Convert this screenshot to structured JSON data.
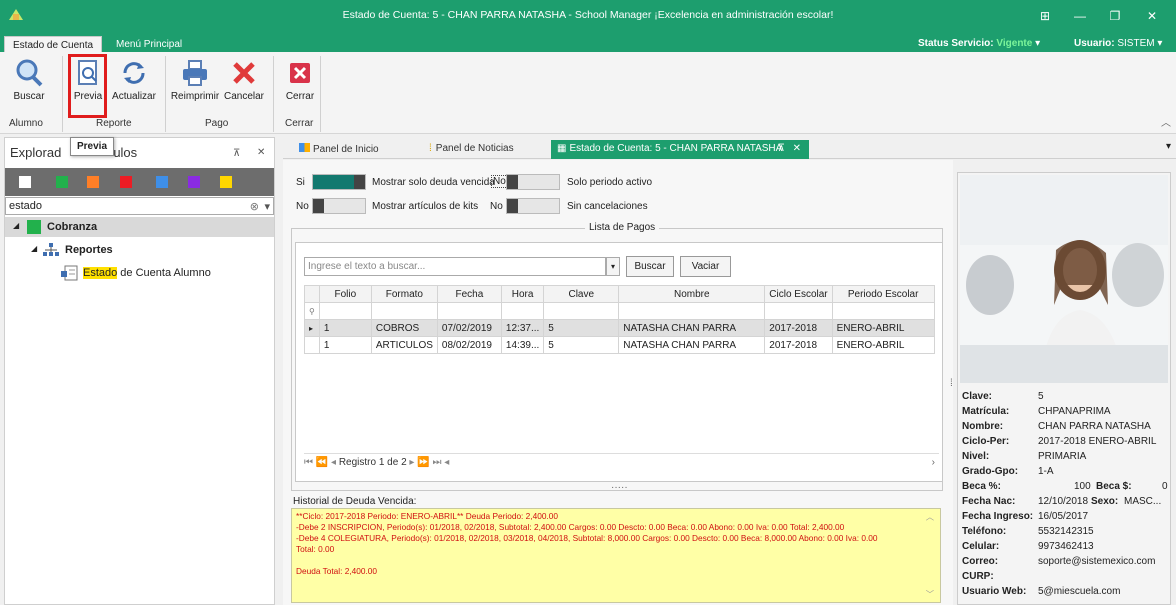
{
  "window": {
    "title": "Estado de Cuenta: 5 - CHAN PARRA NATASHA - School Manager ¡Excelencia en administración escolar!"
  },
  "ribbon_tabs": [
    "Estado de Cuenta",
    "Menú Principal"
  ],
  "status": {
    "servicio_label": "Status Servicio:",
    "servicio_value": "Vigente",
    "usuario_label": "Usuario:",
    "usuario_value": "SISTEM"
  },
  "ribbon": {
    "buttons": {
      "buscar": "Buscar",
      "previa": "Previa",
      "actualizar": "Actualizar",
      "reimprimir": "Reimprimir",
      "cancelar": "Cancelar",
      "cerrar": "Cerrar"
    },
    "groups": [
      "Alumno",
      "Reporte",
      "Pago",
      "Cerrar"
    ]
  },
  "tooltip": "Previa",
  "explorer": {
    "title_start": "Explorad",
    "title_end": "ulos",
    "filter_value": "estado",
    "swatch_colors": [
      "#ffffff",
      "#22b14c",
      "#ff7f27",
      "#ed1c24",
      "#3f8fe8",
      "#8a2be2",
      "#ffd700"
    ],
    "tree": {
      "category": "Cobranza",
      "subcategory": "Reportes",
      "item_highlight": "Estado",
      "item_rest": " de Cuenta Alumno"
    }
  },
  "doc_tabs": [
    "Panel de Inicio",
    "Panel de Noticias",
    "Estado de Cuenta: 5 - CHAN PARRA NATASHA"
  ],
  "filters": {
    "si": "Si",
    "no": "No",
    "deuda_vencida": "Mostrar solo deuda vencida",
    "periodo_activo": "Solo periodo activo",
    "articulos_kits": "Mostrar artículos de kits",
    "sin_cancelaciones": "Sin cancelaciones"
  },
  "pagos": {
    "legend": "Lista de Pagos",
    "search_placeholder": "Ingrese el texto a buscar...",
    "buscar": "Buscar",
    "vaciar": "Vaciar",
    "columns": [
      "Folio",
      "Formato",
      "Fecha",
      "Hora",
      "Clave",
      "Nombre",
      "Ciclo Escolar",
      "Periodo Escolar"
    ],
    "rows": [
      [
        "1",
        "COBROS",
        "07/02/2019",
        "12:37...",
        "5",
        "NATASHA CHAN PARRA",
        "2017-2018",
        "ENERO-ABRIL"
      ],
      [
        "1",
        "ARTICULOS",
        "08/02/2019",
        "14:39...",
        "5",
        "NATASHA CHAN PARRA",
        "2017-2018",
        "ENERO-ABRIL"
      ]
    ],
    "pager": "Registro 1 de 2"
  },
  "historial": {
    "title": "Historial de Deuda Vencida:",
    "lines": [
      "**Ciclo: 2017-2018  Periodo: ENERO-ABRIL** Deuda Periodo: 2,400.00",
      "-Debe 2 INSCRIPCION, Periodo(s): 01/2018, 02/2018,  Subtotal: 2,400.00 Cargos: 0.00 Descto: 0.00 Beca: 0.00 Abono: 0.00 Iva: 0.00 Total: 2,400.00",
      "-Debe 4 COLEGIATURA, Periodo(s): 01/2018, 02/2018, 03/2018, 04/2018,  Subtotal: 8,000.00 Cargos: 0.00 Descto: 0.00 Beca: 8,000.00 Abono: 0.00 Iva: 0.00",
      "Total: 0.00",
      "",
      "Deuda Total: 2,400.00"
    ]
  },
  "profile": {
    "clave_label": "Clave:",
    "clave": "5",
    "matricula_label": "Matrícula:",
    "matricula": "CHPANAPRIMA",
    "nombre_label": "Nombre:",
    "nombre": "CHAN PARRA NATASHA",
    "cicloper_label": "Ciclo-Per:",
    "cicloper": "2017-2018  ENERO-ABRIL",
    "nivel_label": "Nivel:",
    "nivel": "PRIMARIA",
    "grado_label": "Grado-Gpo:",
    "grado": "1-A",
    "beca_pct_label": "Beca %:",
    "beca_pct": "100",
    "beca_amt_label": "Beca $:",
    "beca_amt": "0",
    "fechanac_label": "Fecha Nac:",
    "fechanac": "12/10/2018",
    "sexo_label": "Sexo:",
    "sexo": "MASC...",
    "ingreso_label": "Fecha Ingreso:",
    "ingreso": "16/05/2017",
    "telefono_label": "Teléfono:",
    "telefono": "5532142315",
    "celular_label": "Celular:",
    "celular": "9973462413",
    "correo_label": "Correo:",
    "correo": "soporte@sistemexico.com",
    "curp_label": "CURP:",
    "curp": "",
    "usuarioweb_label": "Usuario Web:",
    "usuarioweb": "5@miescuela.com"
  }
}
